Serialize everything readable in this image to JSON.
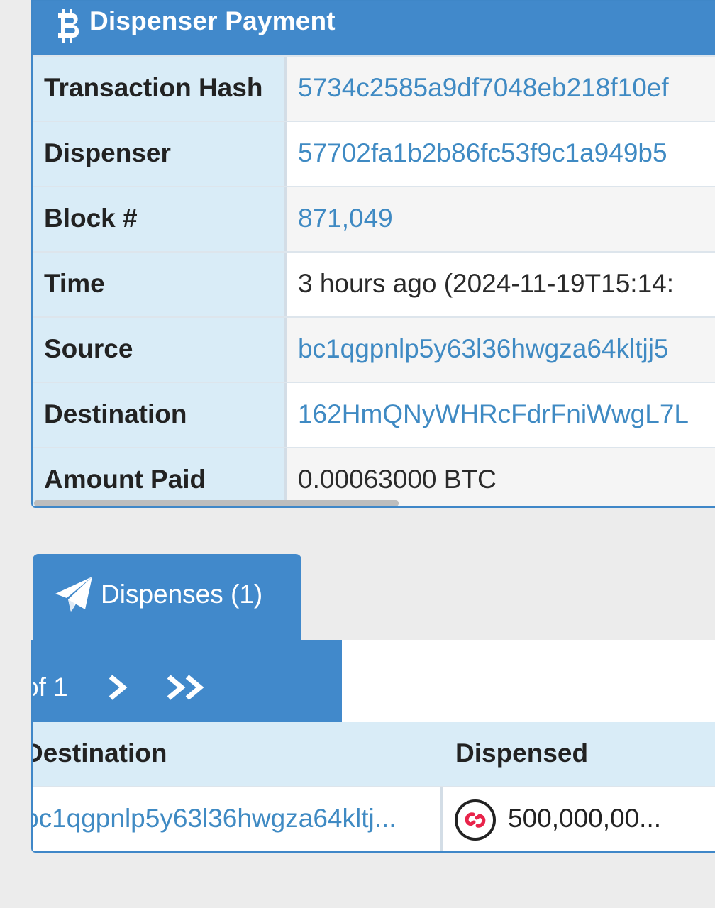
{
  "payment": {
    "title": "Dispenser Payment",
    "rows": [
      {
        "label": "Transaction Hash",
        "value": "5734c2585a9df7048eb218f10ef"
      },
      {
        "label": "Dispenser",
        "value": "57702fa1b2b86fc53f9c1a949b5"
      },
      {
        "label": "Block #",
        "value": "871,049"
      },
      {
        "label": "Time",
        "value": "3 hours ago (2024-11-19T15:14:"
      },
      {
        "label": "Source",
        "value": "bc1qgpnlp5y63l36hwgza64kltjj5"
      },
      {
        "label": "Destination",
        "value": "162HmQNyWHRcFdrFniWwgL7L"
      },
      {
        "label": "Amount Paid",
        "value": "0.00063000 BTC"
      }
    ]
  },
  "dispenses": {
    "tab_label": "Dispenses (1)",
    "pager_text": "of 1",
    "columns": [
      "Destination",
      "Dispensed"
    ],
    "row": {
      "destination": "bc1qgpnlp5y63l36hwgza64kltj...",
      "dispensed": "500,000,00..."
    }
  },
  "icons": {
    "header": "bitcoin-icon",
    "tab": "paper-plane-icon",
    "next": "chevron-right-icon",
    "last": "double-chevron-right-icon",
    "asset": "asset-logo-icon"
  },
  "colors": {
    "header_blue": "#4189cb",
    "link_blue": "#3f8ac3",
    "label_bg": "#d9ecf7",
    "asset_red": "#e8234a"
  }
}
